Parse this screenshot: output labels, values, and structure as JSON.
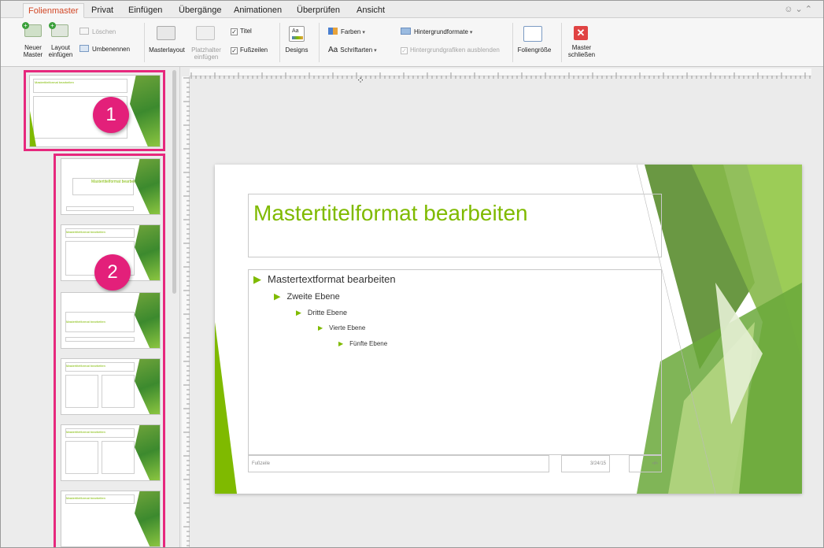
{
  "tabs": [
    {
      "label": "Folienmaster",
      "active": true
    },
    {
      "label": "Privat"
    },
    {
      "label": "Einfügen"
    },
    {
      "label": "Übergänge"
    },
    {
      "label": "Animationen"
    },
    {
      "label": "Überprüfen"
    },
    {
      "label": "Ansicht"
    }
  ],
  "ribbon": {
    "neuer_master": "Neuer Master",
    "layout_einfuegen": "Layout einfügen",
    "loeschen": "Löschen",
    "umbenennen": "Umbenennen",
    "masterlayout": "Masterlayout",
    "platzhalter_einfuegen": "Platzhalter einfügen",
    "titel": "Titel",
    "fusszeilen": "Fußzeilen",
    "designs": "Designs",
    "farben": "Farben",
    "schriftarten": "Schriftarten",
    "hintergrundformate": "Hintergrundformate",
    "hintergrundgrafiken": "Hintergrundgrafiken ausblenden",
    "foliengroesse": "Foliengröße",
    "master_schliessen": "Master schließen"
  },
  "thumbnails": {
    "master_title": "Mastertitelformat bearbeiten",
    "layout_title_short": "Mastertitelformat bearbeiten"
  },
  "badges": {
    "one": "1",
    "two": "2"
  },
  "slide": {
    "title": "Mastertitelformat bearbeiten",
    "levels": [
      "Mastertextformat bearbeiten",
      "Zweite Ebene",
      "Dritte Ebene",
      "Vierte Ebene",
      "Fünfte Ebene"
    ],
    "footer": "Fußzeile",
    "date": "3/24/15",
    "slide_number": "‹#›"
  },
  "colors": {
    "accent_tab": "#d24726",
    "title_green": "#7fba00",
    "highlight_pink": "#e6287d",
    "close_red": "#e04343"
  }
}
